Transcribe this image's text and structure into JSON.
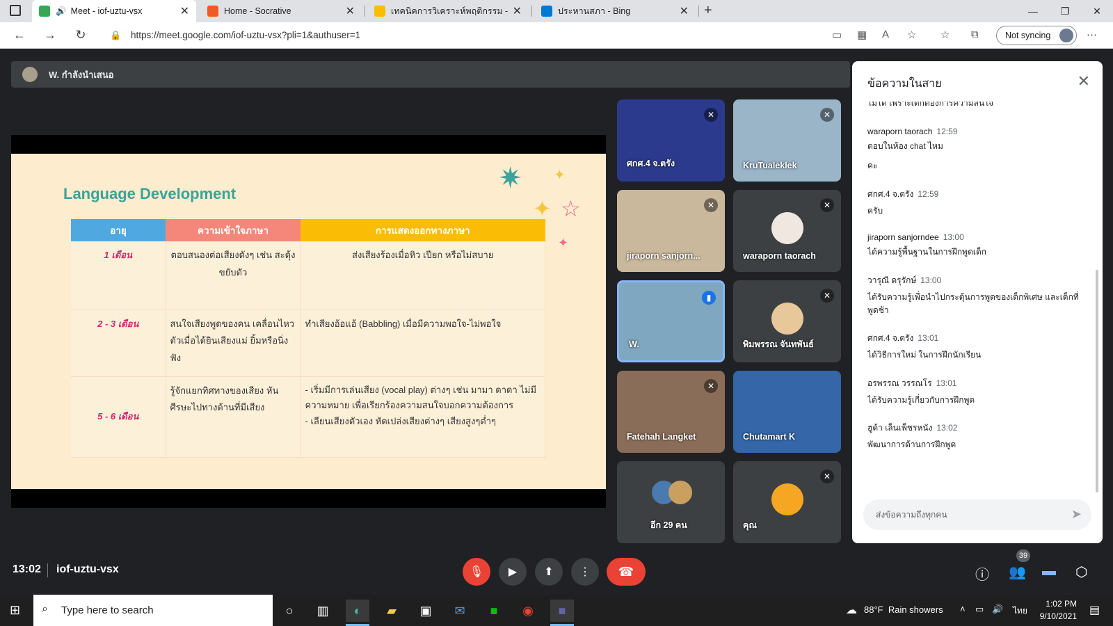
{
  "browser": {
    "tabs": [
      {
        "title": "Meet - iof-uztu-vsx",
        "color": "#34a853",
        "active": true
      },
      {
        "title": "Home - Socrative",
        "color": "#f15a24",
        "active": false
      },
      {
        "title": "เทคนิคการวิเคราะห์พฤติกรรม - Goog",
        "color": "#fbbc04",
        "active": false
      },
      {
        "title": "ประหานสภา - Bing",
        "color": "#0078d4",
        "active": false
      }
    ],
    "url": "https://meet.google.com/iof-uztu-vsx?pli=1&authuser=1",
    "sync_label": "Not syncing"
  },
  "presenter": {
    "label": "W. กำลังนำเสนอ"
  },
  "slide": {
    "title": "Language Development",
    "headers": [
      "อายุ",
      "ความเข้าใจภาษา",
      "การแสดงออกทางภาษา"
    ],
    "header_colors": [
      "#4fa8df",
      "#f4877a",
      "#fbbc05"
    ],
    "rows": [
      {
        "age": "1 เดือน",
        "understand": "ตอบสนองต่อเสียงดังๆ เช่น สะดุ้ง ขยับตัว",
        "express": "ส่งเสียงร้องเมื่อหิว เปียก หรือไม่สบาย"
      },
      {
        "age": "2 - 3 เดือน",
        "understand": "สนใจเสียงพูดของคน เคลื่อนไหวตัวเมื่อได้ยินเสียงแม่ ยิ้มหรือนิ่งฟัง",
        "express": "ทำเสียงอ้อแอ้ (Babbling) เมื่อมีความพอใจ-ไม่พอใจ"
      },
      {
        "age": "5 - 6 เดือน",
        "understand": "รู้จักแยกทิศทางของเสียง หันศีรษะไปทางด้านที่มีเสียง",
        "express": "- เริ่มมีการเล่นเสียง (vocal play) ต่างๆ เช่น มามา ดาดา ไม่มีความหมาย เพื่อเรียกร้องความสนใจบอกความต้องการ\n- เลียนเสียงตัวเอง หัดเปล่งเสียงต่างๆ เสียงสูงๆต่ำๆ"
      }
    ]
  },
  "participants": [
    {
      "name": "ศกศ.4 จ.ตรัง",
      "muted": true,
      "bg": "#2b3a8c"
    },
    {
      "name": "KruTualeklek",
      "muted": true,
      "bg": "#9ab4c8"
    },
    {
      "name": "jiraporn sanjorn...",
      "muted": true,
      "bg": "#c9b89c"
    },
    {
      "name": "waraporn taorach",
      "muted": true,
      "bg": "#3c4043"
    },
    {
      "name": "W.",
      "muted": false,
      "bg": "#7fa7c0"
    },
    {
      "name": "พิมพรรณ จันทพันธ์",
      "muted": true,
      "bg": "#3c4043"
    },
    {
      "name": "Fatehah Langket",
      "muted": true,
      "bg": "#8a6d58"
    },
    {
      "name": "Chutamart K",
      "muted": false,
      "bg": "#3466a8"
    },
    {
      "name": "อีก 29 คน",
      "muted": false,
      "bg": "#3c4043"
    },
    {
      "name": "คุณ",
      "muted": true,
      "bg": "#3c4043"
    }
  ],
  "chat": {
    "title": "ข้อความในสาย",
    "top_partial": "ไม่ได้ เพราะเด็กต้องการความสนใจ",
    "messages": [
      {
        "sender": "waraporn taorach",
        "time": "12:59",
        "text": "ตอบในห้อง chat ไหม"
      },
      {
        "sender": "",
        "time": "",
        "text": "คะ"
      },
      {
        "sender": "ศกศ.4 จ.ตรัง",
        "time": "12:59",
        "text": "ครับ"
      },
      {
        "sender": "jiraporn sanjorndee",
        "time": "13:00",
        "text": "ได้ความรู้พื้นฐานในการฝึกพูดเด็ก"
      },
      {
        "sender": "วารุณี ดรุรักษ์",
        "time": "13:00",
        "text": "ได้รับความรู้เพื่อนำไปกระตุ้นการพูดของเด็กพิเศษ และเด็กที่พูดช้า"
      },
      {
        "sender": "ศกศ.4 จ.ตรัง",
        "time": "13:01",
        "text": "ได้วิธีการใหม่ ในการฝึกนักเรียน"
      },
      {
        "sender": "อรพรรณ วรรณโร",
        "time": "13:01",
        "text": "ได้รับความรู้เกี่ยวกับการฝึกพูด"
      },
      {
        "sender": "ฮูด้า เล็นเพ็ชรหนัง",
        "time": "13:02",
        "text": "พัฒนาการด้านการฝึกพูด"
      }
    ],
    "input_placeholder": "ส่งข้อความถึงทุกคน"
  },
  "meeting": {
    "time": "13:02",
    "code": "iof-uztu-vsx",
    "people_count": "39"
  },
  "taskbar": {
    "search_placeholder": "Type here to search",
    "weather": "88°F  Rain showers",
    "lang": "ไทย",
    "clock_time": "1:02 PM",
    "clock_date": "9/10/2021"
  }
}
